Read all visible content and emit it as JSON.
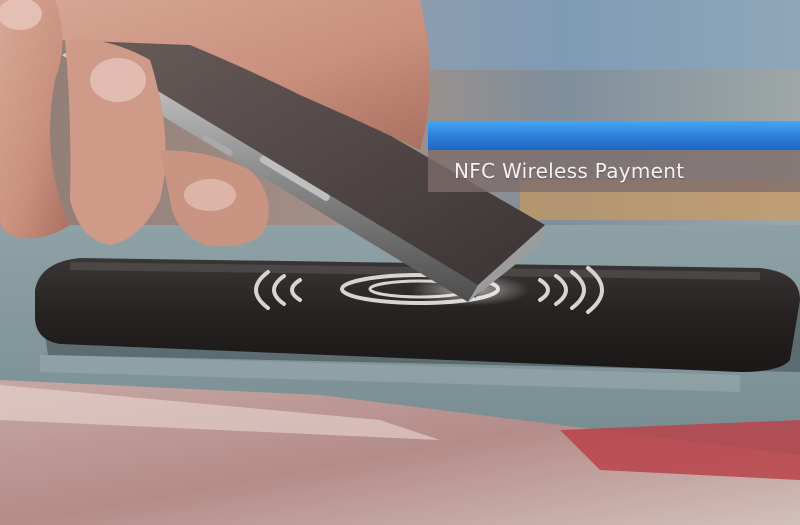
{
  "caption": {
    "text": "NFC Wireless Payment",
    "accent_color": "#2b7fda"
  },
  "scene": {
    "icons": [
      "contactless-waves-icon",
      "phone"
    ]
  }
}
